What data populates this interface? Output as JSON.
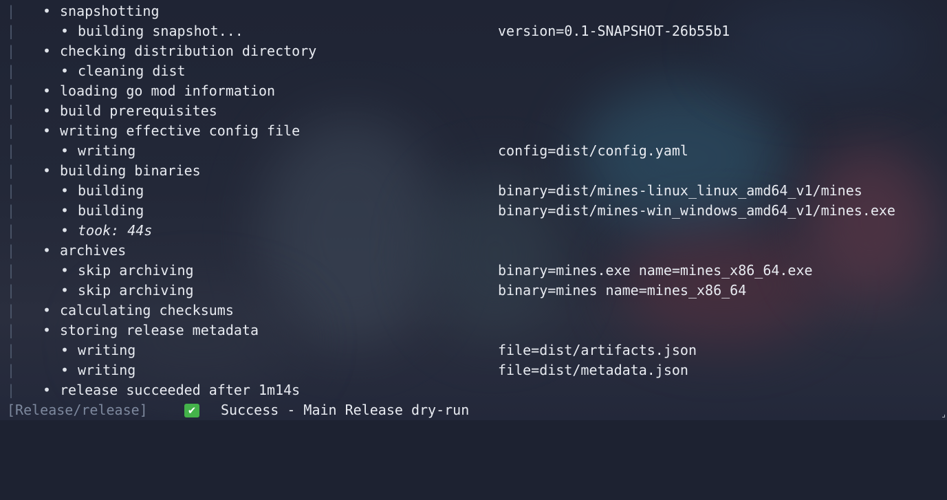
{
  "terminal": {
    "gutter_char": "|",
    "bullet_char": "•",
    "lines": [
      {
        "level": 1,
        "text": "snapshotting",
        "field": ""
      },
      {
        "level": 2,
        "text": "building snapshot...",
        "field": "version=0.1-SNAPSHOT-26b55b1"
      },
      {
        "level": 1,
        "text": "checking distribution directory",
        "field": ""
      },
      {
        "level": 2,
        "text": "cleaning dist",
        "field": ""
      },
      {
        "level": 1,
        "text": "loading go mod information",
        "field": ""
      },
      {
        "level": 1,
        "text": "build prerequisites",
        "field": ""
      },
      {
        "level": 1,
        "text": "writing effective config file",
        "field": ""
      },
      {
        "level": 2,
        "text": "writing",
        "field": "config=dist/config.yaml"
      },
      {
        "level": 1,
        "text": "building binaries",
        "field": ""
      },
      {
        "level": 2,
        "text": "building",
        "field": "binary=dist/mines-linux_linux_amd64_v1/mines"
      },
      {
        "level": 2,
        "text": "building",
        "field": "binary=dist/mines-win_windows_amd64_v1/mines.exe"
      },
      {
        "level": 2,
        "text": "took: 44s",
        "field": "",
        "italic": true
      },
      {
        "level": 1,
        "text": "archives",
        "field": ""
      },
      {
        "level": 2,
        "text": "skip archiving",
        "field": "binary=mines.exe name=mines_x86_64.exe"
      },
      {
        "level": 2,
        "text": "skip archiving",
        "field": "binary=mines name=mines_x86_64"
      },
      {
        "level": 1,
        "text": "calculating checksums",
        "field": ""
      },
      {
        "level": 1,
        "text": "storing release metadata",
        "field": ""
      },
      {
        "level": 2,
        "text": "writing",
        "field": "file=dist/artifacts.json"
      },
      {
        "level": 2,
        "text": "writing",
        "field": "file=dist/metadata.json"
      },
      {
        "level": 1,
        "text": "release succeeded after 1m14s",
        "field": ""
      }
    ]
  },
  "footer": {
    "job_label": "[Release/release]",
    "status_icon": "check-mark-icon",
    "status_icon_glyph": "✔",
    "status_text": "Success - Main Release dry-run",
    "status_color": "#44b24a"
  },
  "cursor_glyph": "⌟"
}
